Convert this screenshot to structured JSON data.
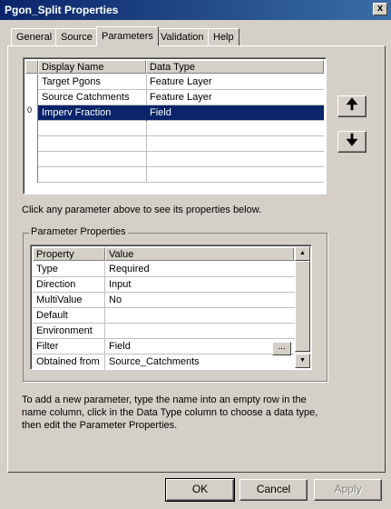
{
  "window": {
    "title": "Pgon_Split Properties",
    "close_glyph": "x"
  },
  "tabs": [
    {
      "label": "General"
    },
    {
      "label": "Source"
    },
    {
      "label": "Parameters"
    },
    {
      "label": "Validation"
    },
    {
      "label": "Help"
    }
  ],
  "active_tab": "Parameters",
  "params_table": {
    "headers": [
      "Display Name",
      "Data Type"
    ],
    "rows": [
      {
        "name": "Target Pgons",
        "type": "Feature Layer",
        "selected": false
      },
      {
        "name": "Source Catchments",
        "type": "Feature Layer",
        "selected": false
      },
      {
        "name": "Imperv Fraction",
        "type": "Field",
        "selected": true,
        "marker": "0"
      }
    ]
  },
  "move_up_glyph": "🠉",
  "move_down_glyph": "🠋",
  "hint_text": "Click any parameter above to see its properties below.",
  "param_props": {
    "group_label": "Parameter Properties",
    "headers": [
      "Property",
      "Value"
    ],
    "rows": [
      {
        "property": "Type",
        "value": "Required"
      },
      {
        "property": "Direction",
        "value": "Input"
      },
      {
        "property": "MultiValue",
        "value": "No"
      },
      {
        "property": "Default",
        "value": ""
      },
      {
        "property": "Environment",
        "value": ""
      },
      {
        "property": "Filter",
        "value": "Field"
      },
      {
        "property": "Obtained from",
        "value": "Source_Catchments"
      }
    ],
    "ellipsis_label": "...",
    "scroll_up_glyph": "▲",
    "scroll_down_glyph": "▼"
  },
  "instructions": {
    "line1": "To add a new parameter, type the name into an empty row in the",
    "line2": "name column, click in the Data Type column to choose a data type,",
    "line3": "then edit the Parameter Properties."
  },
  "buttons": {
    "ok": "OK",
    "cancel": "Cancel",
    "apply": "Apply"
  },
  "colors": {
    "title_bar": "#0a246a",
    "selection": "#0a246a",
    "face": "#d4d0c8"
  }
}
